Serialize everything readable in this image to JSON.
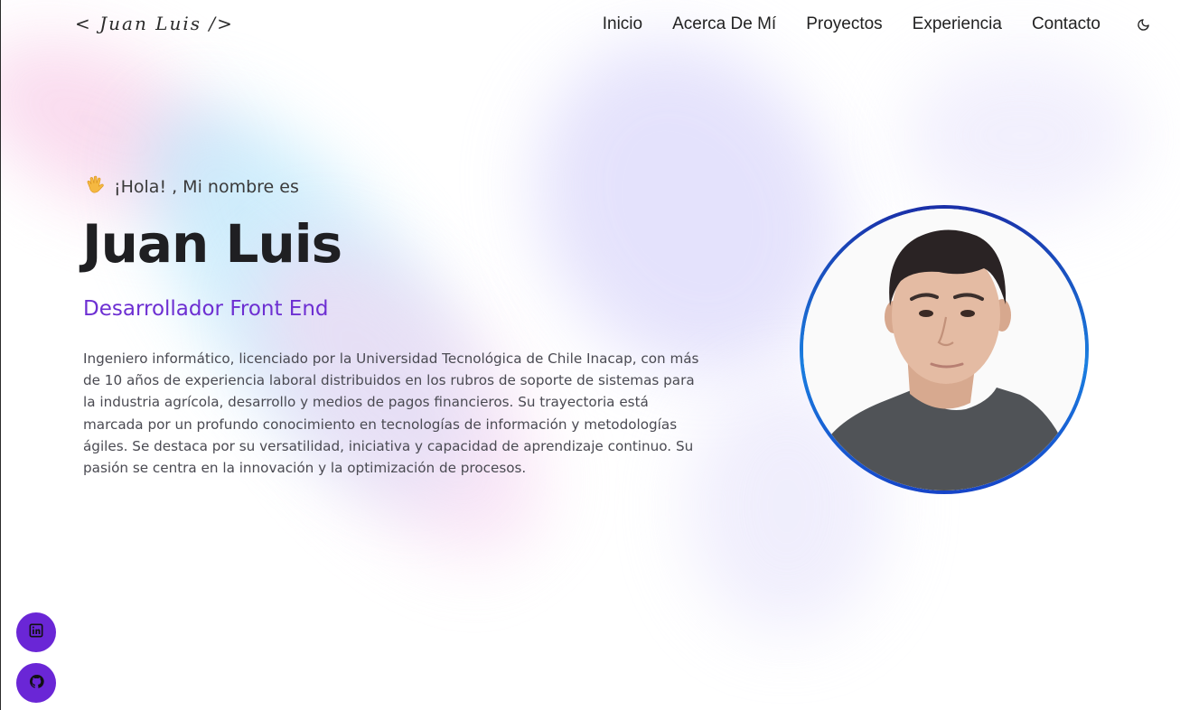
{
  "header": {
    "logo": "< Juan Luis />",
    "nav": [
      "Inicio",
      "Acerca De Mí",
      "Proyectos",
      "Experiencia",
      "Contacto"
    ],
    "theme_icon": "moon-icon"
  },
  "hero": {
    "wave_icon": "waving-hand-icon",
    "greeting": "¡Hola! , Mi nombre es",
    "name": "Juan Luis",
    "role": "Desarrollador Front End",
    "bio": "Ingeniero informático, licenciado por la Universidad Tecnológica de Chile Inacap, con más de 10 años de experiencia laboral distribuidos en los rubros de soporte de sistemas para la industria agrícola, desarrollo y medios de pagos financieros. Su trayectoria está marcada por un profundo conocimiento en tecnologías de información y metodologías ágiles. Se destaca por su versatilidad, iniciativa y capacidad de aprendizaje continuo. Su pasión se centra en la innovación y la optimización de procesos."
  },
  "social": [
    {
      "icon": "linkedin-icon"
    },
    {
      "icon": "github-icon"
    }
  ],
  "colors": {
    "accent": "#6d2fd2",
    "social_button": "#6a26d6",
    "ring_top": "#1a2fa8",
    "ring_mid": "#1a7fe0"
  }
}
